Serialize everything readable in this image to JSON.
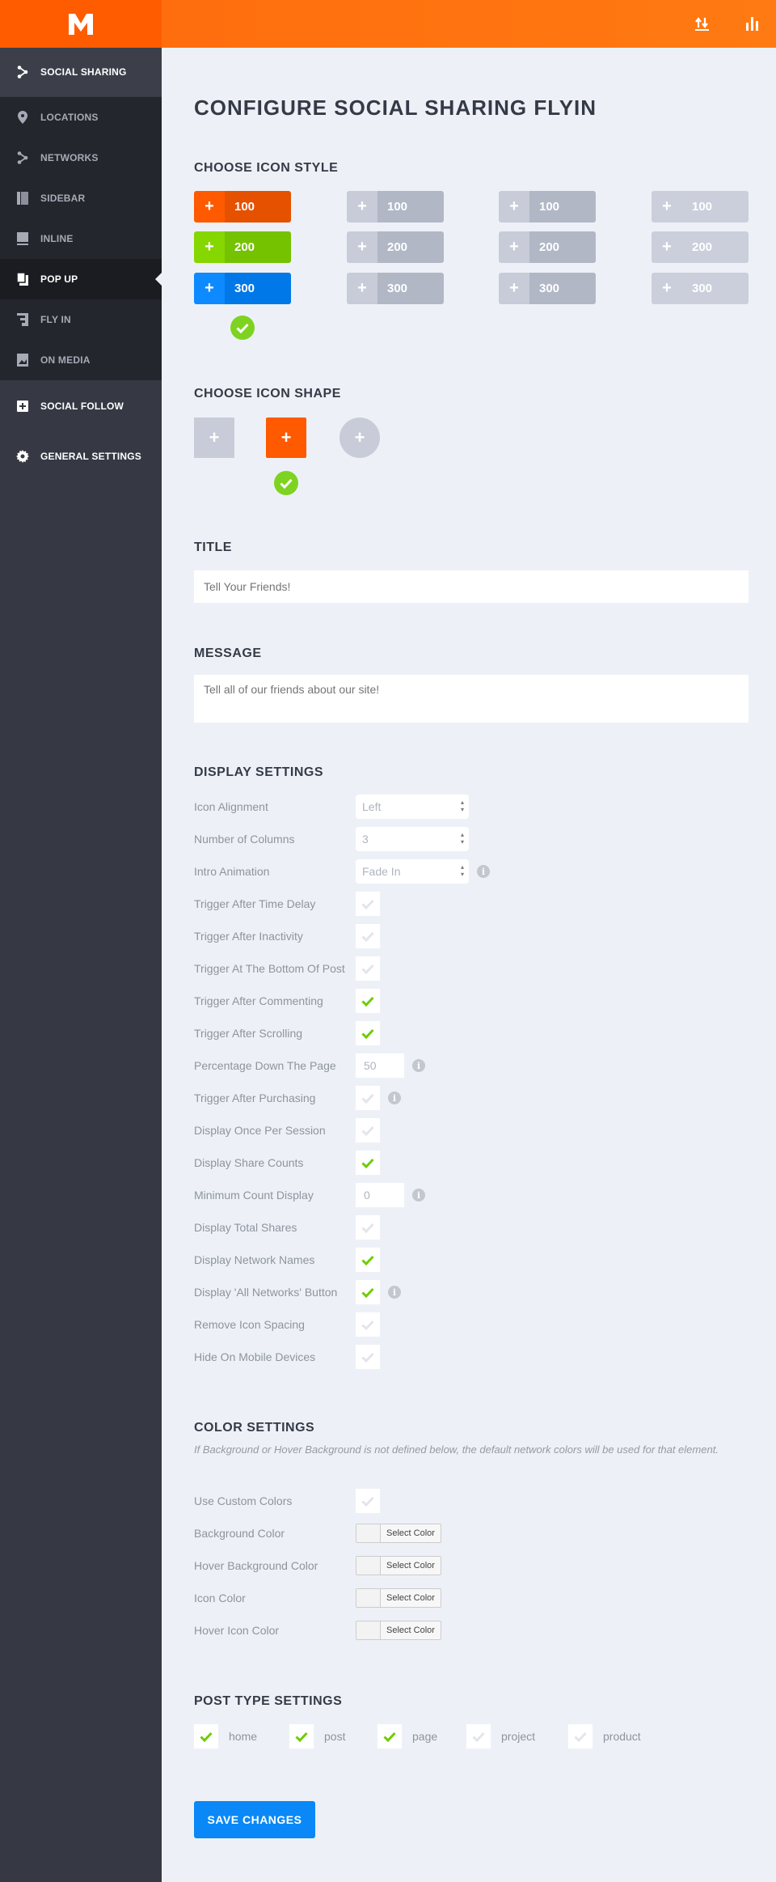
{
  "header": {
    "logo": "M",
    "icons": [
      "import-export-icon",
      "stats-icon"
    ]
  },
  "sidebar": {
    "sections": [
      {
        "label": "SOCIAL SHARING",
        "icon": "share-icon"
      },
      {
        "label": "SOCIAL FOLLOW",
        "icon": "plus-square-icon"
      },
      {
        "label": "GENERAL SETTINGS",
        "icon": "gear-icon"
      }
    ],
    "sub_items": [
      {
        "label": "LOCATIONS",
        "icon": "map-pin-icon"
      },
      {
        "label": "NETWORKS",
        "icon": "share-icon"
      },
      {
        "label": "SIDEBAR",
        "icon": "sidebar-icon"
      },
      {
        "label": "INLINE",
        "icon": "inline-icon"
      },
      {
        "label": "POP UP",
        "icon": "popup-icon",
        "active": true
      },
      {
        "label": "FLY IN",
        "icon": "flyin-icon"
      },
      {
        "label": "ON MEDIA",
        "icon": "image-icon"
      }
    ]
  },
  "page": {
    "title": "CONFIGURE SOCIAL SHARING FLYIN"
  },
  "icon_style": {
    "heading": "CHOOSE ICON STYLE",
    "selected": 0,
    "styles": [
      {
        "rows": [
          "100",
          "200",
          "300"
        ]
      },
      {
        "rows": [
          "100",
          "200",
          "300"
        ]
      },
      {
        "rows": [
          "100",
          "200",
          "300"
        ]
      },
      {
        "rows": [
          "100",
          "200",
          "300"
        ]
      }
    ]
  },
  "icon_shape": {
    "heading": "CHOOSE ICON SHAPE",
    "shapes": [
      "square",
      "rounded",
      "circle"
    ],
    "selected": 1
  },
  "title_field": {
    "heading": "TITLE",
    "placeholder": "Tell Your Friends!"
  },
  "message_field": {
    "heading": "MESSAGE",
    "placeholder": "Tell all of our friends about our site!"
  },
  "display": {
    "heading": "DISPLAY SETTINGS",
    "rows": [
      {
        "label": "Icon Alignment",
        "type": "select",
        "value": "Left"
      },
      {
        "label": "Number of Columns",
        "type": "select",
        "value": "3"
      },
      {
        "label": "Intro Animation",
        "type": "select",
        "value": "Fade In",
        "info": true
      },
      {
        "label": "Trigger After Time Delay",
        "type": "checkbox",
        "checked": false
      },
      {
        "label": "Trigger After Inactivity",
        "type": "checkbox",
        "checked": false
      },
      {
        "label": "Trigger At The Bottom Of Post",
        "type": "checkbox",
        "checked": false
      },
      {
        "label": "Trigger After Commenting",
        "type": "checkbox",
        "checked": true
      },
      {
        "label": "Trigger After Scrolling",
        "type": "checkbox",
        "checked": true
      },
      {
        "label": "Percentage Down The Page",
        "type": "text",
        "value": "50",
        "info": true
      },
      {
        "label": "Trigger After Purchasing",
        "type": "checkbox",
        "checked": false,
        "info": true
      },
      {
        "label": "Display Once Per Session",
        "type": "checkbox",
        "checked": false
      },
      {
        "label": "Display Share Counts",
        "type": "checkbox",
        "checked": true
      },
      {
        "label": "Minimum Count Display",
        "type": "text",
        "value": "0",
        "info": true
      },
      {
        "label": "Display Total Shares",
        "type": "checkbox",
        "checked": false
      },
      {
        "label": "Display Network Names",
        "type": "checkbox",
        "checked": true
      },
      {
        "label": "Display 'All Networks' Button",
        "type": "checkbox",
        "checked": true,
        "info": true
      },
      {
        "label": "Remove Icon Spacing",
        "type": "checkbox",
        "checked": false
      },
      {
        "label": "Hide On Mobile Devices",
        "type": "checkbox",
        "checked": false
      }
    ]
  },
  "colors": {
    "heading": "COLOR SETTINGS",
    "note": "If Background or Hover Background is not defined below, the default network colors will be used for that element.",
    "rows": [
      {
        "label": "Use Custom Colors",
        "type": "checkbox",
        "checked": false
      },
      {
        "label": "Background Color",
        "type": "color",
        "button": "Select Color"
      },
      {
        "label": "Hover Background Color",
        "type": "color",
        "button": "Select Color"
      },
      {
        "label": "Icon Color",
        "type": "color",
        "button": "Select Color"
      },
      {
        "label": "Hover Icon Color",
        "type": "color",
        "button": "Select Color"
      }
    ]
  },
  "post_types": {
    "heading": "POST TYPE SETTINGS",
    "items": [
      {
        "label": "home",
        "checked": true
      },
      {
        "label": "post",
        "checked": true
      },
      {
        "label": "page",
        "checked": true
      },
      {
        "label": "project",
        "checked": false
      },
      {
        "label": "product",
        "checked": false
      }
    ]
  },
  "save_label": "SAVE CHANGES",
  "theme": {
    "accent": "#ff6a0c",
    "check_green": "#7ed321",
    "save_blue": "#0a88f7",
    "sidebar": "#363943",
    "background": "#edf1f7"
  }
}
